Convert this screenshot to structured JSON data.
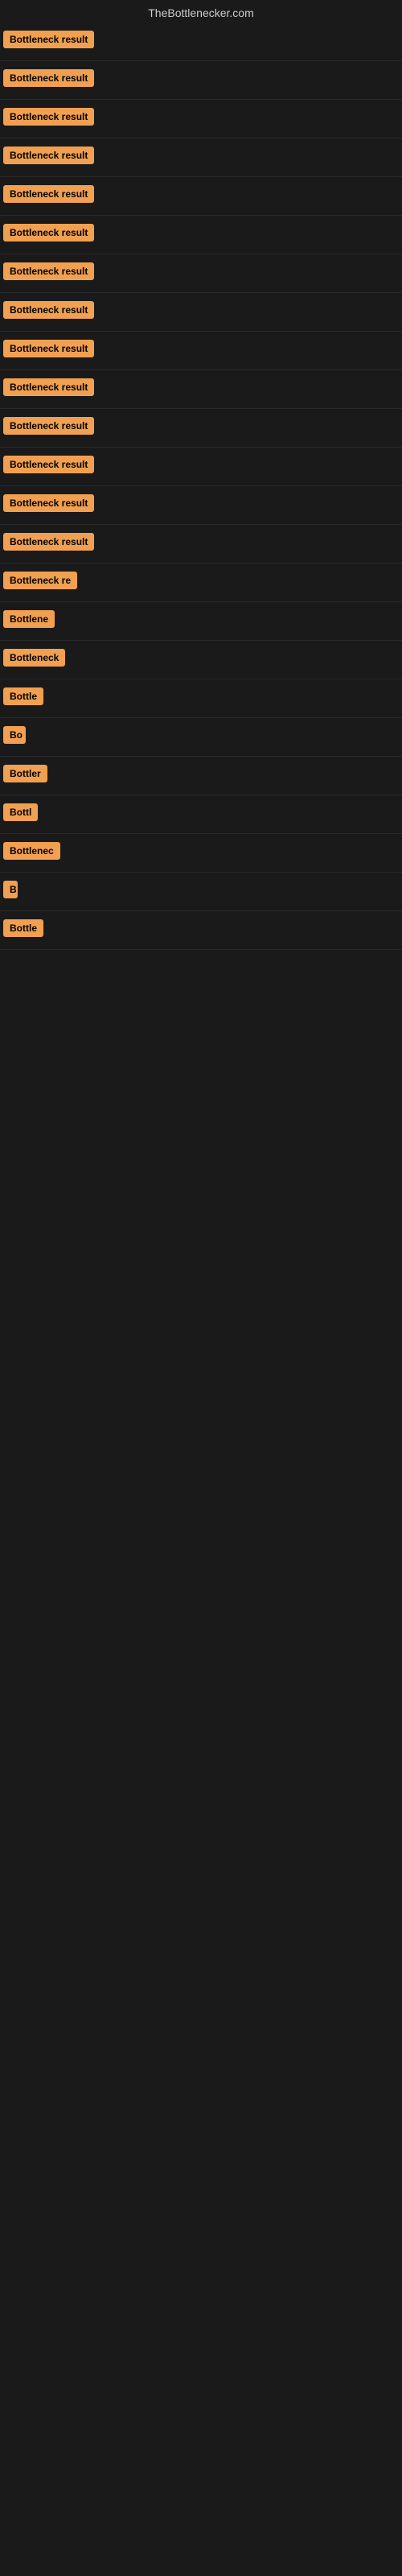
{
  "site": {
    "title": "TheBottlenecker.com"
  },
  "results": [
    {
      "id": 1,
      "label": "Bottleneck result",
      "width": 130
    },
    {
      "id": 2,
      "label": "Bottleneck result",
      "width": 130
    },
    {
      "id": 3,
      "label": "Bottleneck result",
      "width": 130
    },
    {
      "id": 4,
      "label": "Bottleneck result",
      "width": 130
    },
    {
      "id": 5,
      "label": "Bottleneck result",
      "width": 130
    },
    {
      "id": 6,
      "label": "Bottleneck result",
      "width": 130
    },
    {
      "id": 7,
      "label": "Bottleneck result",
      "width": 130
    },
    {
      "id": 8,
      "label": "Bottleneck result",
      "width": 130
    },
    {
      "id": 9,
      "label": "Bottleneck result",
      "width": 130
    },
    {
      "id": 10,
      "label": "Bottleneck result",
      "width": 130
    },
    {
      "id": 11,
      "label": "Bottleneck result",
      "width": 130
    },
    {
      "id": 12,
      "label": "Bottleneck result",
      "width": 120
    },
    {
      "id": 13,
      "label": "Bottleneck result",
      "width": 120
    },
    {
      "id": 14,
      "label": "Bottleneck result",
      "width": 120
    },
    {
      "id": 15,
      "label": "Bottleneck re",
      "width": 95
    },
    {
      "id": 16,
      "label": "Bottlene",
      "width": 75
    },
    {
      "id": 17,
      "label": "Bottleneck",
      "width": 82
    },
    {
      "id": 18,
      "label": "Bottle",
      "width": 58
    },
    {
      "id": 19,
      "label": "Bo",
      "width": 28
    },
    {
      "id": 20,
      "label": "Bottler",
      "width": 58
    },
    {
      "id": 21,
      "label": "Bottl",
      "width": 50
    },
    {
      "id": 22,
      "label": "Bottlenec",
      "width": 75
    },
    {
      "id": 23,
      "label": "B",
      "width": 18
    },
    {
      "id": 24,
      "label": "Bottle",
      "width": 58
    }
  ]
}
